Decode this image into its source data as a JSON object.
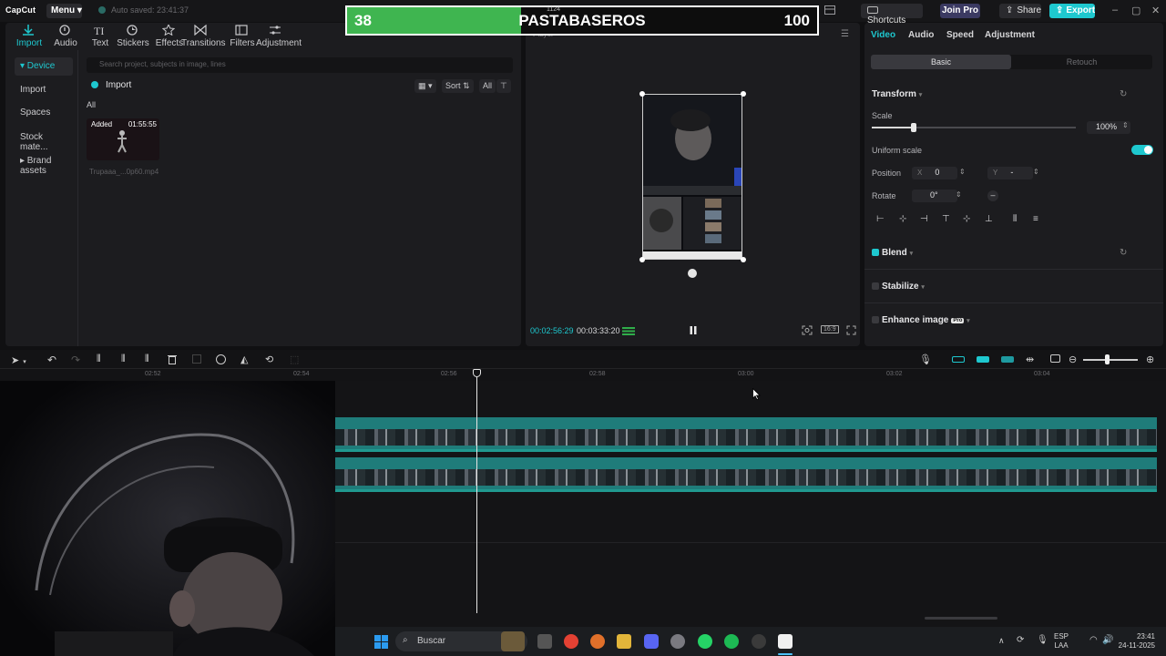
{
  "titlebar": {
    "logo": "CapCut",
    "menu": "Menu",
    "autosave": "Auto saved: 23:41:37",
    "shortcuts": "Shortcuts",
    "join_pro": "Join Pro",
    "share": "Share",
    "export": "Export"
  },
  "overlay": {
    "left_score": "38",
    "title": "PASTABASEROS",
    "right_score": "100",
    "progress_percent": 37,
    "canvas_label": "1124"
  },
  "toolbar": {
    "items": [
      {
        "label": "Import",
        "icon": "import-icon",
        "active": true
      },
      {
        "label": "Audio",
        "icon": "audio-icon"
      },
      {
        "label": "Text",
        "icon": "text-icon"
      },
      {
        "label": "Stickers",
        "icon": "stickers-icon"
      },
      {
        "label": "Effects",
        "icon": "effects-icon"
      },
      {
        "label": "Transitions",
        "icon": "transitions-icon"
      },
      {
        "label": "Filters",
        "icon": "filters-icon"
      },
      {
        "label": "Adjustment",
        "icon": "adjustment-icon"
      }
    ]
  },
  "sidebar": {
    "items": [
      {
        "label": "▾ Device",
        "active": true
      },
      {
        "label": "Import"
      },
      {
        "label": "Spaces"
      },
      {
        "label": "Stock mate..."
      },
      {
        "label": "▸ Brand assets"
      }
    ]
  },
  "media": {
    "search_placeholder": "Search project, subjects in image, lines",
    "import_label": "Import",
    "all_label": "All",
    "sort_label": "Sort",
    "filter_all": "All",
    "clip": {
      "badge": "Added",
      "duration": "01:55:55",
      "filename": "Trupaaa_...0p60.mp4"
    }
  },
  "player": {
    "label": "Player",
    "current_time": "00:02:56:29",
    "total_time": "00:03:33:20",
    "ratio_label": "16:9"
  },
  "props": {
    "tabs": [
      "Video",
      "Audio",
      "Speed",
      "Adjustment"
    ],
    "active_tab": "Video",
    "seg_basic": "Basic",
    "seg_retouch": "Retouch",
    "transform_title": "Transform",
    "scale_label": "Scale",
    "scale_value": "100%",
    "scale_fraction": 0.2,
    "uniform_label": "Uniform scale",
    "position_label": "Position",
    "pos_x_label": "X",
    "pos_x_value": "0",
    "pos_y_label": "Y",
    "pos_y_value": "-",
    "rotate_label": "Rotate",
    "rotate_value": "0°",
    "blend_label": "Blend",
    "stabilize_label": "Stabilize",
    "enhance_label": "Enhance image",
    "pro_badge": "Pro"
  },
  "timeline": {
    "ticks": [
      "02:52",
      "02:54",
      "02:56",
      "02:58",
      "03:00",
      "03:02",
      "03:04"
    ]
  },
  "taskbar": {
    "search": "Buscar",
    "lang": "ESP",
    "layout": "LAA",
    "time": "23:41",
    "date": "24-11-2025"
  }
}
